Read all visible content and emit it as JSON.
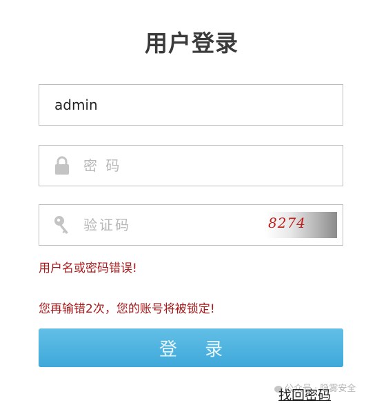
{
  "title": "用户登录",
  "username": {
    "value": "admin"
  },
  "password": {
    "placeholder": "密 码"
  },
  "captcha": {
    "placeholder": "验证码",
    "image_text": "8274"
  },
  "errors": {
    "message_1": "用户名或密码错误!",
    "message_2": "您再输错2次，您的账号将被锁定!"
  },
  "login_button": {
    "label": "登 录"
  },
  "forgot_password": {
    "label": "找回密码"
  },
  "watermark": {
    "text": "公众号 · 隐雾安全"
  },
  "colors": {
    "error": "#a8191b",
    "button": "#3ea8da",
    "captcha_text": "#c0201c"
  },
  "icons": {
    "password": "lock-icon",
    "captcha": "key-icon"
  }
}
